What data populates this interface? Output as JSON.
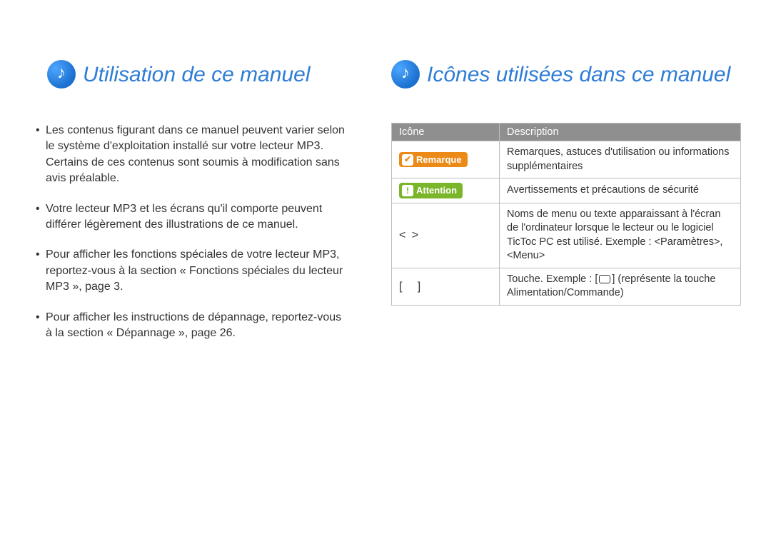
{
  "left": {
    "title": "Utilisation de ce manuel",
    "bullets": [
      "Les contenus figurant dans ce manuel peuvent varier selon le système d'exploitation installé sur votre lecteur MP3. Certains de ces contenus sont soumis à modification sans avis préalable.",
      "Votre lecteur MP3 et les écrans qu'il comporte peuvent différer légèrement des illustrations de ce manuel.",
      "Pour afficher les fonctions spéciales de votre lecteur MP3, reportez-vous à la section « Fonctions spéciales du lecteur MP3 », page 3.",
      "Pour afficher les instructions de dépannage, reportez-vous à la section « Dépannage », page 26."
    ]
  },
  "right": {
    "title": "Icônes utilisées dans ce manuel",
    "headers": {
      "icon": "Icône",
      "desc": "Description"
    },
    "rows": {
      "remarque": {
        "badge": "Remarque",
        "desc": "Remarques, astuces d'utilisation ou informations supplémentaires"
      },
      "attention": {
        "badge": "Attention",
        "desc": "Avertissements et précautions de sécurité"
      },
      "menu": {
        "symbol": "<   >",
        "desc": "Noms de menu ou texte apparaissant à l'écran de l'ordinateur lorsque le lecteur ou le logiciel TicToc PC est utilisé. Exemple : <Paramètres>, <Menu>"
      },
      "key": {
        "symbol_open": "[",
        "symbol_close": "]",
        "desc_prefix": "Touche. Exemple : [",
        "desc_suffix": "] (représente la touche Alimentation/Commande)"
      }
    }
  }
}
